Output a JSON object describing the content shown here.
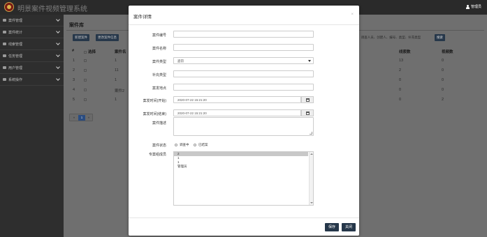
{
  "app": {
    "title": "明景案件视频管理系统",
    "user": "管理员"
  },
  "sidebar": {
    "items": [
      {
        "label": "案件管理"
      },
      {
        "label": "案件统计"
      },
      {
        "label": "线索管理"
      },
      {
        "label": "任务管理"
      },
      {
        "label": "用户管理"
      },
      {
        "label": "系统操作"
      }
    ]
  },
  "main": {
    "title": "案件库",
    "toolbar": {
      "new_case": "新建案件",
      "edit_case": "更改案件信息"
    },
    "search": {
      "hint": "、 调查人员、创建人、编号、类型、补充类型",
      "button": "搜索"
    },
    "table": {
      "headers": {
        "index": "#",
        "select": "选择",
        "case_name": "案件名",
        "clue_count": "线索数",
        "video_count": "视频数"
      },
      "rows": [
        {
          "index": "1",
          "case_name": "1",
          "clue_count": "13",
          "video_count": "0"
        },
        {
          "index": "2",
          "case_name": "11",
          "clue_count": "2",
          "video_count": "0"
        },
        {
          "index": "3",
          "case_name": "1",
          "clue_count": "0",
          "video_count": "0"
        },
        {
          "index": "4",
          "case_name": "案件2",
          "clue_count": "0",
          "video_count": "0"
        },
        {
          "index": "5",
          "case_name": "1",
          "clue_count": "0",
          "video_count": "2"
        }
      ]
    },
    "pager": {
      "prev": "«",
      "current": "1",
      "next": "»"
    }
  },
  "modal": {
    "title": "案件详情",
    "close": "×",
    "labels": {
      "case_no": "案件编号",
      "case_name": "案件名称",
      "case_type": "案件类型",
      "sub_type": "补充类型",
      "location": "案发地点",
      "time_start": "案发时间(开始)",
      "time_end": "案发时间(结束)",
      "description": "案件描述",
      "status": "案件状态",
      "members": "专案组成员"
    },
    "values": {
      "case_type": "盗窃",
      "time_start": "2020-07-22 15:21:20",
      "time_end": "2020-07-22 15:21:20"
    },
    "status_options": [
      "调查中",
      "已结案"
    ],
    "members": [
      "2",
      "1",
      "1",
      "管理员"
    ],
    "buttons": {
      "save": "保存",
      "close": "关闭"
    }
  }
}
